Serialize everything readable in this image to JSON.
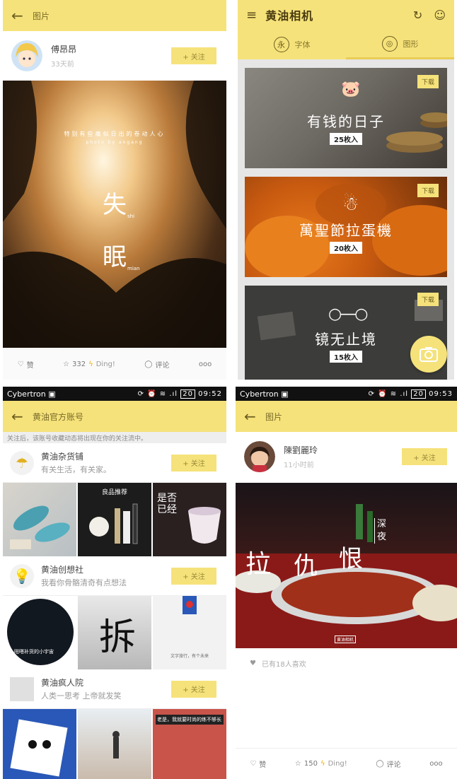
{
  "post1": {
    "header_title": "图片",
    "user": {
      "name": "傅昂昂",
      "time": "33天前"
    },
    "follow_label": "+ 关注",
    "photo": {
      "top_caption": "特别有些痛似日出的卷动人心",
      "credit": "photo by angang",
      "big1": "失",
      "sub1": "shi",
      "big2": "眠",
      "sub2": "mian"
    },
    "actions": {
      "like": "赞",
      "star_count": "332",
      "ding": "Ding!",
      "comment": "评论",
      "more": "ooo"
    }
  },
  "fonts_screen": {
    "app_title": "黄油相机",
    "tabs": [
      {
        "icon": "永",
        "label": "字体"
      },
      {
        "icon": "◎",
        "label": "图形"
      }
    ],
    "cards": [
      {
        "name": "有钱的日子",
        "count": "25枚入",
        "download": "下载"
      },
      {
        "name": "萬聖節拉蛋機",
        "count": "20枚入",
        "download": "下载"
      },
      {
        "name": "镜无止境",
        "count": "15枚入",
        "download": "下载"
      }
    ]
  },
  "accounts_screen": {
    "status": {
      "carrier": "Cybertron",
      "time": "09:52",
      "battery": "20"
    },
    "header_title": "黄油官方账号",
    "notice": "关注后，该账号收藏动态将出现在你的关注流中。",
    "accounts": [
      {
        "name": "黄油杂货铺",
        "desc": "有关生活，有关家。",
        "follow": "+ 关注"
      },
      {
        "name": "黄油创想社",
        "desc": "我看你骨骼清奇有点想法",
        "follow": "+ 关注"
      },
      {
        "name": "黄油疯人院",
        "desc": "人类一思考 上帝就发笑",
        "follow": "+ 关注"
      }
    ],
    "strip1_text": {
      "product": "良品推荐",
      "poem": "是否已经"
    },
    "strip2_text": {
      "circle": "啪嗒补货的小宇宙",
      "char": "拆",
      "sign": "文字旅行，有个未来"
    },
    "strip3_text": {
      "banner": "老是，我就要时尚的练不够长"
    }
  },
  "post2": {
    "status": {
      "carrier": "Cybertron",
      "time": "09:53",
      "battery": "20"
    },
    "header_title": "图片",
    "user": {
      "name": "陳劉麗玲",
      "time": "11小时前"
    },
    "follow_label": "+ 关注",
    "photo": {
      "text_a": "拉",
      "text_b": "仇",
      "text_c": "恨",
      "text_d": "深夜",
      "logo": "黄油相机"
    },
    "likes_text": "已有18人喜欢",
    "actions": {
      "like": "赞",
      "star_count": "150",
      "ding": "Ding!",
      "comment": "评论",
      "more": "ooo"
    }
  }
}
